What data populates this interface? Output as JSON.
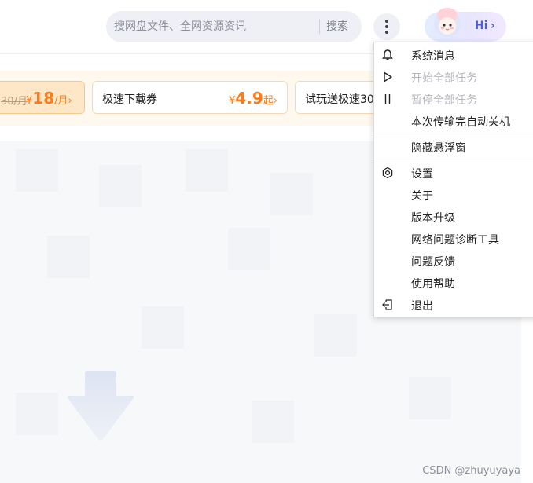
{
  "header": {
    "search_placeholder": "搜网盘文件、全网资源资讯",
    "search_button": "搜索",
    "hi_label": "Hi",
    "hi_chevron": "›"
  },
  "promo": {
    "card1": {
      "old_price": "30/月",
      "currency": "¥",
      "price": "18",
      "unit": "/月",
      "chevron": "›"
    },
    "card2": {
      "label": "极速下载券",
      "currency": "¥",
      "price": "4.9",
      "unit": "起",
      "chevron": "›"
    },
    "card3": {
      "label": "试玩送极速30"
    }
  },
  "menu": {
    "items": [
      {
        "label": "系统消息",
        "icon": "bell-icon",
        "enabled": true
      },
      {
        "label": "开始全部任务",
        "icon": "play-icon",
        "enabled": false
      },
      {
        "label": "暂停全部任务",
        "icon": "pause-icon",
        "enabled": false
      },
      {
        "label": "本次传输完自动关机",
        "icon": "",
        "enabled": true
      },
      {
        "label": "隐藏悬浮窗",
        "icon": "",
        "enabled": true
      },
      {
        "label": "设置",
        "icon": "gear-icon",
        "enabled": true
      },
      {
        "label": "关于",
        "icon": "",
        "enabled": true
      },
      {
        "label": "版本升级",
        "icon": "",
        "enabled": true
      },
      {
        "label": "网络问题诊断工具",
        "icon": "",
        "enabled": true
      },
      {
        "label": "问题反馈",
        "icon": "",
        "enabled": true
      },
      {
        "label": "使用帮助",
        "icon": "",
        "enabled": true
      },
      {
        "label": "退出",
        "icon": "exit-icon",
        "enabled": true
      }
    ]
  },
  "watermark": "CSDN @zhuyuyaya",
  "colors": {
    "accent_orange": "#ff7a1a",
    "accent_blue": "#4a5be0",
    "disabled_text": "#b4b6bd"
  }
}
